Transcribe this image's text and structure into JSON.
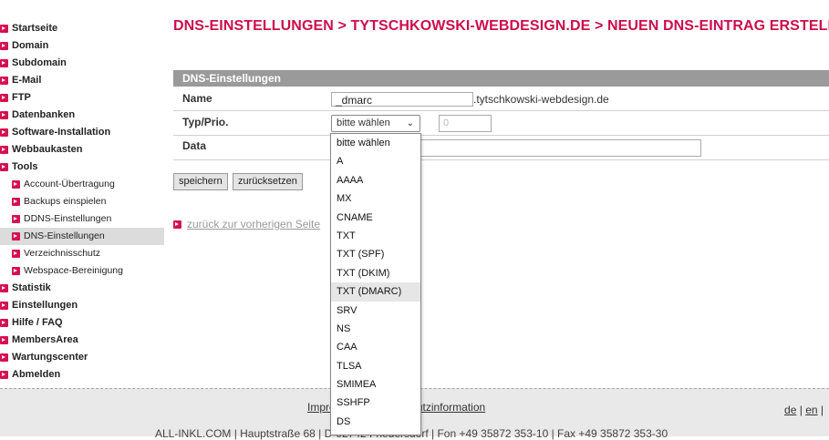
{
  "sidebar": {
    "items": [
      {
        "label": "Startseite"
      },
      {
        "label": "Domain"
      },
      {
        "label": "Subdomain"
      },
      {
        "label": "E-Mail"
      },
      {
        "label": "FTP"
      },
      {
        "label": "Datenbanken"
      },
      {
        "label": "Software-Installation"
      },
      {
        "label": "Webbaukasten"
      },
      {
        "label": "Tools"
      },
      {
        "label": "Account-Übertragung"
      },
      {
        "label": "Backups einspielen"
      },
      {
        "label": "DDNS-Einstellungen"
      },
      {
        "label": "DNS-Einstellungen"
      },
      {
        "label": "Verzeichnisschutz"
      },
      {
        "label": "Webspace-Bereinigung"
      },
      {
        "label": "Statistik"
      },
      {
        "label": "Einstellungen"
      },
      {
        "label": "Hilfe / FAQ"
      },
      {
        "label": "MembersArea"
      },
      {
        "label": "Wartungscenter"
      },
      {
        "label": "Abmelden"
      }
    ]
  },
  "page": {
    "title": "DNS-EINSTELLUNGEN > TYTSCHKOWSKI-WEBDESIGN.DE > NEUEN DNS-EINTRAG ERSTELLEN"
  },
  "form": {
    "section_title": "DNS-Einstellungen",
    "name_label": "Name",
    "name_value": "_dmarc",
    "name_suffix": ".tytschkowski-webdesign.de",
    "type_label": "Typ/Prio.",
    "type_selected": "bitte wählen",
    "prio_value": "0",
    "data_label": "Data",
    "data_value": "",
    "save_button": "speichern",
    "reset_button": "zurücksetzen",
    "back_link": "zurück zur vorherigen Seite"
  },
  "dropdown": {
    "options": [
      "bitte wählen",
      "A",
      "AAAA",
      "MX",
      "CNAME",
      "TXT",
      "TXT (SPF)",
      "TXT (DKIM)",
      "TXT (DMARC)",
      "SRV",
      "NS",
      "CAA",
      "TLSA",
      "SMIMEA",
      "SSHFP",
      "DS"
    ],
    "highlighted": "TXT (DMARC)"
  },
  "footer": {
    "links_text": "Impressum | Datenschutzinformation",
    "lang_de": "de",
    "lang_en": "en",
    "address": "ALL-INKL.COM | Hauptstraße 68 | D-02742 Friedersdorf | Fon +49 35872 353-10 | Fax +49 35872 353-30"
  },
  "colors": {
    "accent": "#cc0e4c",
    "section_bar": "#9a9a9a",
    "active_nav": "#dcdcdc"
  }
}
